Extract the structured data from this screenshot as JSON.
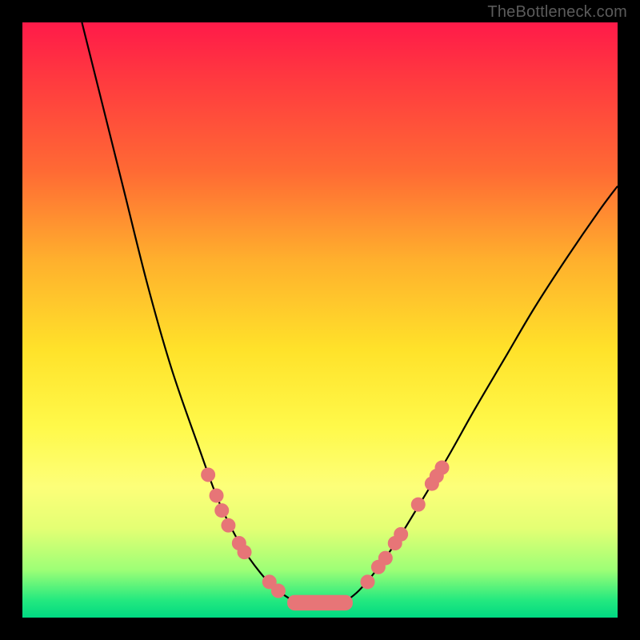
{
  "watermark": "TheBottleneck.com",
  "chart_data": {
    "type": "line",
    "title": "",
    "xlabel": "",
    "ylabel": "",
    "xlim": [
      0,
      100
    ],
    "ylim": [
      0,
      100
    ],
    "grid": false,
    "curve_comment": "Two smooth arms descending into a flat valley; x in percent of width, y in percent of height (0=top).",
    "left_arm": [
      {
        "x": 10.0,
        "y": 0.0
      },
      {
        "x": 13.0,
        "y": 12.0
      },
      {
        "x": 17.0,
        "y": 28.0
      },
      {
        "x": 21.0,
        "y": 44.0
      },
      {
        "x": 25.0,
        "y": 58.0
      },
      {
        "x": 29.5,
        "y": 71.0
      },
      {
        "x": 33.0,
        "y": 80.5
      },
      {
        "x": 36.5,
        "y": 87.5
      },
      {
        "x": 40.0,
        "y": 92.5
      },
      {
        "x": 43.0,
        "y": 95.5
      },
      {
        "x": 46.0,
        "y": 97.5
      }
    ],
    "valley": [
      {
        "x": 46.0,
        "y": 97.5
      },
      {
        "x": 50.0,
        "y": 97.8
      },
      {
        "x": 54.0,
        "y": 97.5
      }
    ],
    "right_arm": [
      {
        "x": 54.0,
        "y": 97.5
      },
      {
        "x": 56.5,
        "y": 95.5
      },
      {
        "x": 59.5,
        "y": 92.0
      },
      {
        "x": 63.0,
        "y": 87.0
      },
      {
        "x": 67.0,
        "y": 80.5
      },
      {
        "x": 71.5,
        "y": 73.0
      },
      {
        "x": 76.0,
        "y": 65.0
      },
      {
        "x": 81.0,
        "y": 56.5
      },
      {
        "x": 86.0,
        "y": 48.0
      },
      {
        "x": 91.5,
        "y": 39.5
      },
      {
        "x": 97.0,
        "y": 31.5
      },
      {
        "x": 100.0,
        "y": 27.5
      }
    ],
    "dots_left": [
      {
        "x": 31.2,
        "y": 76.0
      },
      {
        "x": 32.6,
        "y": 79.5
      },
      {
        "x": 33.5,
        "y": 82.0
      },
      {
        "x": 34.6,
        "y": 84.5
      },
      {
        "x": 36.4,
        "y": 87.5
      },
      {
        "x": 37.3,
        "y": 89.0
      },
      {
        "x": 41.5,
        "y": 94.0
      },
      {
        "x": 43.0,
        "y": 95.5
      }
    ],
    "dots_right": [
      {
        "x": 58.0,
        "y": 94.0
      },
      {
        "x": 59.8,
        "y": 91.5
      },
      {
        "x": 61.0,
        "y": 90.0
      },
      {
        "x": 62.6,
        "y": 87.5
      },
      {
        "x": 63.6,
        "y": 86.0
      },
      {
        "x": 66.5,
        "y": 81.0
      },
      {
        "x": 68.8,
        "y": 77.5
      },
      {
        "x": 69.6,
        "y": 76.2
      },
      {
        "x": 70.5,
        "y": 74.8
      }
    ],
    "valley_bar": {
      "x1": 44.5,
      "x2": 55.5,
      "y": 97.5,
      "r": 1.3
    }
  }
}
